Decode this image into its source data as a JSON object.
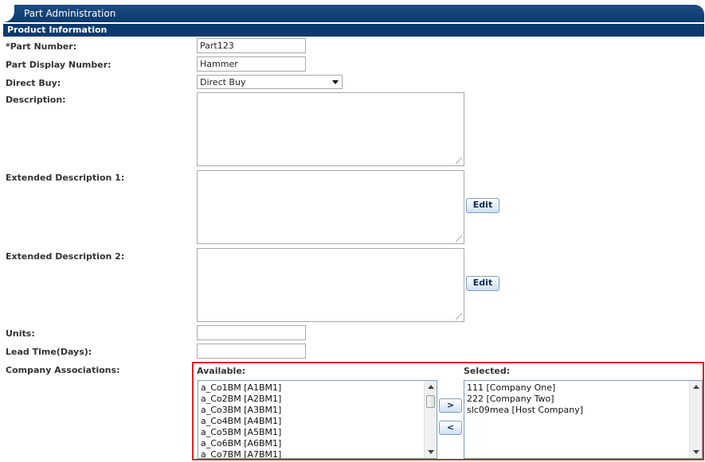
{
  "header": {
    "title": "Part Administration"
  },
  "section": {
    "title": "Product Information"
  },
  "form": {
    "part_number": {
      "label": "*Part Number:",
      "value": "Part123"
    },
    "part_display_number": {
      "label": "Part Display Number:",
      "value": "Hammer"
    },
    "direct_buy": {
      "label": "Direct Buy:",
      "value": "Direct Buy"
    },
    "description": {
      "label": "Description:",
      "value": ""
    },
    "ext_desc_1": {
      "label": "Extended Description 1:",
      "value": "",
      "edit_label": "Edit"
    },
    "ext_desc_2": {
      "label": "Extended Description 2:",
      "value": "",
      "edit_label": "Edit"
    },
    "units": {
      "label": "Units:",
      "value": ""
    },
    "lead_time": {
      "label": "Lead Time(Days):",
      "value": ""
    },
    "company_associations": {
      "label": "Company Associations:",
      "available_label": "Available:",
      "selected_label": "Selected:",
      "add_label": ">",
      "remove_label": "<",
      "available": [
        "a_Co1BM [A1BM1]",
        "a_Co2BM [A2BM1]",
        "a_Co3BM [A3BM1]",
        "a_Co4BM [A4BM1]",
        "a_Co5BM [A5BM1]",
        "a_Co6BM [A6BM1]",
        "a_Co7BM [A7BM1]"
      ],
      "selected": [
        "111 [Company One]",
        "222 [Company Two]",
        "slc09mea [Host Company]"
      ]
    }
  }
}
